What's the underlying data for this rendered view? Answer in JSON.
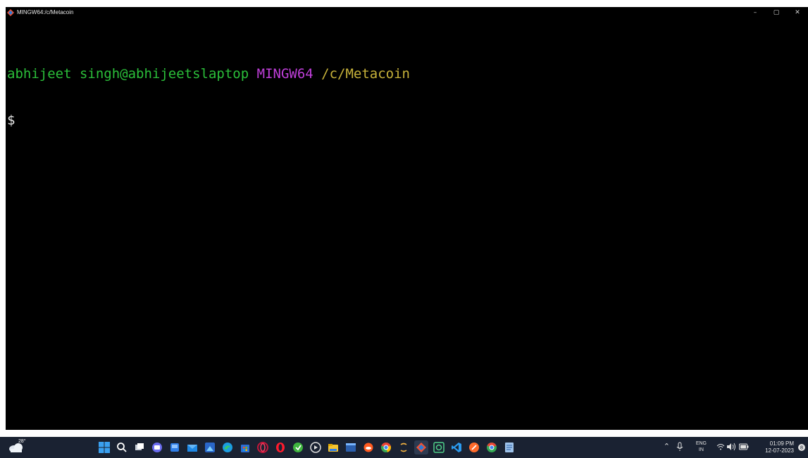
{
  "window": {
    "title": "MINGW64:/c/Metacoin",
    "controls": {
      "minimize": "–",
      "maximize": "▢",
      "close": "✕"
    }
  },
  "terminal": {
    "user_host": "abhijeet singh@abhijeetslaptop",
    "system": "MINGW64",
    "path": "/c/Metacoin",
    "prompt": "$",
    "colors": {
      "user": "#2bbf3a",
      "system": "#bf3fd9",
      "path": "#c7b23a",
      "background": "#000000"
    }
  },
  "taskbar": {
    "weather": {
      "icon": "cloud-icon",
      "temperature": "28°"
    },
    "apps": [
      {
        "name": "start-icon"
      },
      {
        "name": "search-icon"
      },
      {
        "name": "task-view-icon"
      },
      {
        "name": "chat-icon"
      },
      {
        "name": "widgets-icon"
      },
      {
        "name": "mail-icon"
      },
      {
        "name": "photos-icon"
      },
      {
        "name": "edge-icon"
      },
      {
        "name": "store-icon"
      },
      {
        "name": "opera-icon"
      },
      {
        "name": "opera-gx-icon"
      },
      {
        "name": "app-green-icon"
      },
      {
        "name": "media-player-icon"
      },
      {
        "name": "file-explorer-icon"
      },
      {
        "name": "terminal-icon"
      },
      {
        "name": "app-orange-icon"
      },
      {
        "name": "chrome-icon"
      },
      {
        "name": "app-sync-icon"
      },
      {
        "name": "git-bash-icon"
      },
      {
        "name": "app-grid-icon"
      },
      {
        "name": "vscode-icon"
      },
      {
        "name": "app-compass-icon"
      },
      {
        "name": "chrome-alt-icon"
      },
      {
        "name": "notepad-icon"
      }
    ],
    "tray": {
      "language_top": "ENG",
      "language_bottom": "IN",
      "time": "01:09 PM",
      "date": "12-07-2023"
    }
  }
}
